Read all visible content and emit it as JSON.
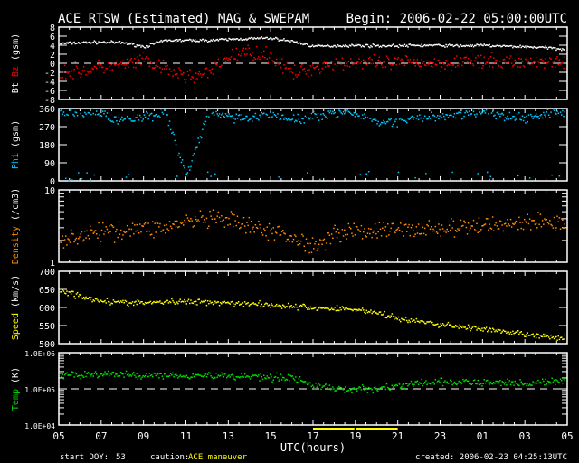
{
  "title": "ACE RTSW (Estimated) MAG & SWEPAM",
  "begin": "Begin: 2006-02-22 05:00:00UTC",
  "footer": {
    "start_doy_label": "start DOY:",
    "start_doy": "53",
    "caution_label": "caution:",
    "caution_text": "ACE maneuver",
    "created": "created: 2006-02-23 04:25:13UTC"
  },
  "colors": {
    "bt": "#ffffff",
    "bz": "#ff0000",
    "phi": "#00c8ff",
    "density": "#ff8c00",
    "speed": "#ffff00",
    "temp": "#00e000",
    "caution": "#ffff00"
  },
  "chart_data": {
    "type": "scatter",
    "xlabel": "UTC(hours)",
    "x_ticks": [
      "05",
      "07",
      "09",
      "11",
      "13",
      "15",
      "17",
      "19",
      "21",
      "23",
      "01",
      "03",
      "05"
    ],
    "x_range_hours": [
      0,
      24
    ],
    "caution_interval_hours": [
      12,
      16
    ],
    "panels": [
      {
        "id": "mag",
        "ylabel_parts": [
          {
            "text": "Bt ",
            "color": "bt"
          },
          {
            "text": "Bz",
            "color": "bz"
          },
          {
            "text": " (gsm)",
            "color": "bt"
          }
        ],
        "ylim": [
          -8,
          8
        ],
        "scale": "linear",
        "yticks": [
          "8",
          "6",
          "4",
          "2",
          "0",
          "-2",
          "-4",
          "-6",
          "-8"
        ],
        "tick_values": [
          8,
          6,
          4,
          2,
          0,
          -2,
          -4,
          -6,
          -8
        ],
        "dashed_at": 0,
        "series": [
          {
            "name": "Bt",
            "color": "bt",
            "noise": 0.15,
            "values": [
              4.3,
              4.5,
              4.6,
              4.5,
              3.6,
              5,
              5,
              5,
              5.2,
              5.4,
              5.5,
              4.8,
              3.7,
              3.8,
              3.9,
              3.8,
              3.8,
              3.9,
              3.9,
              3.8,
              3.9,
              3.7,
              3.6,
              3.4,
              3.0
            ]
          },
          {
            "name": "Bz",
            "color": "bz",
            "noise": 0.8,
            "values": [
              -2,
              -1.8,
              -1,
              -0.5,
              0.5,
              -1.5,
              -3,
              -2.5,
              1.5,
              2.5,
              1.5,
              -2.5,
              -1,
              0,
              0.2,
              -0.3,
              0,
              0.3,
              -0.2,
              0.5,
              0,
              0.3,
              0,
              0.5,
              0.3
            ]
          }
        ]
      },
      {
        "id": "phi",
        "ylabel_parts": [
          {
            "text": "Phi",
            "color": "phi"
          },
          {
            "text": " (gsm)",
            "color": "bt"
          }
        ],
        "ylim": [
          0,
          360
        ],
        "scale": "linear",
        "yticks": [
          "360",
          "270",
          "180",
          "90",
          "0"
        ],
        "tick_values": [
          360,
          270,
          180,
          90,
          0
        ],
        "series": [
          {
            "name": "Phi",
            "color": "phi",
            "noise": 12,
            "wrap": true,
            "values": [
              335,
              340,
              330,
              300,
              320,
              340,
              20,
              330,
              320,
              310,
              330,
              300,
              320,
              340,
              330,
              300,
              290,
              310,
              320,
              330,
              340,
              320,
              310,
              330,
              340
            ]
          }
        ]
      },
      {
        "id": "density",
        "ylabel_parts": [
          {
            "text": "Density",
            "color": "density"
          },
          {
            "text": " (/cm3)",
            "color": "bt"
          }
        ],
        "ylim": [
          1,
          10
        ],
        "scale": "log",
        "yticks": [
          "10",
          "1"
        ],
        "tick_values": [
          10,
          1
        ],
        "series": [
          {
            "name": "Density",
            "color": "density",
            "noise": 0.06,
            "values": [
              2.0,
              2.3,
              2.6,
              2.8,
              2.9,
              3.0,
              3.6,
              3.8,
              3.7,
              3.0,
              2.6,
              2.2,
              1.6,
              2.5,
              2.7,
              2.7,
              2.8,
              2.8,
              2.9,
              2.9,
              3.2,
              3.4,
              3.5,
              3.6,
              3.4
            ]
          }
        ]
      },
      {
        "id": "speed",
        "ylabel_parts": [
          {
            "text": "Speed",
            "color": "speed"
          },
          {
            "text": " (km/s)",
            "color": "bt"
          }
        ],
        "ylim": [
          500,
          700
        ],
        "scale": "linear",
        "yticks": [
          "700",
          "650",
          "600",
          "550",
          "500"
        ],
        "tick_values": [
          700,
          650,
          600,
          550,
          500
        ],
        "series": [
          {
            "name": "Speed",
            "color": "speed",
            "noise": 4,
            "values": [
              648,
              630,
              618,
              612,
              612,
              614,
              615,
              615,
              612,
              610,
              606,
              602,
              598,
              596,
              594,
              585,
              568,
              560,
              552,
              546,
              540,
              530,
              525,
              518,
              512
            ]
          }
        ]
      },
      {
        "id": "temp",
        "ylabel_parts": [
          {
            "text": "Temp",
            "color": "temp"
          },
          {
            "text": " (K)",
            "color": "bt"
          }
        ],
        "ylim": [
          10000,
          1000000
        ],
        "scale": "log",
        "yticks": [
          "1.0E+06",
          "1.0E+05",
          "1.0E+04"
        ],
        "tick_values": [
          1000000,
          100000,
          10000
        ],
        "dashed_at": 100000,
        "series": [
          {
            "name": "Temp",
            "color": "temp",
            "noise": 0.05,
            "values": [
              250000,
              240000,
              250000,
              240000,
              230000,
              240000,
              230000,
              230000,
              220000,
              220000,
              210000,
              200000,
              120000,
              100000,
              95000,
              100000,
              120000,
              140000,
              150000,
              150000,
              140000,
              150000,
              140000,
              150000,
              160000
            ]
          }
        ]
      }
    ]
  }
}
